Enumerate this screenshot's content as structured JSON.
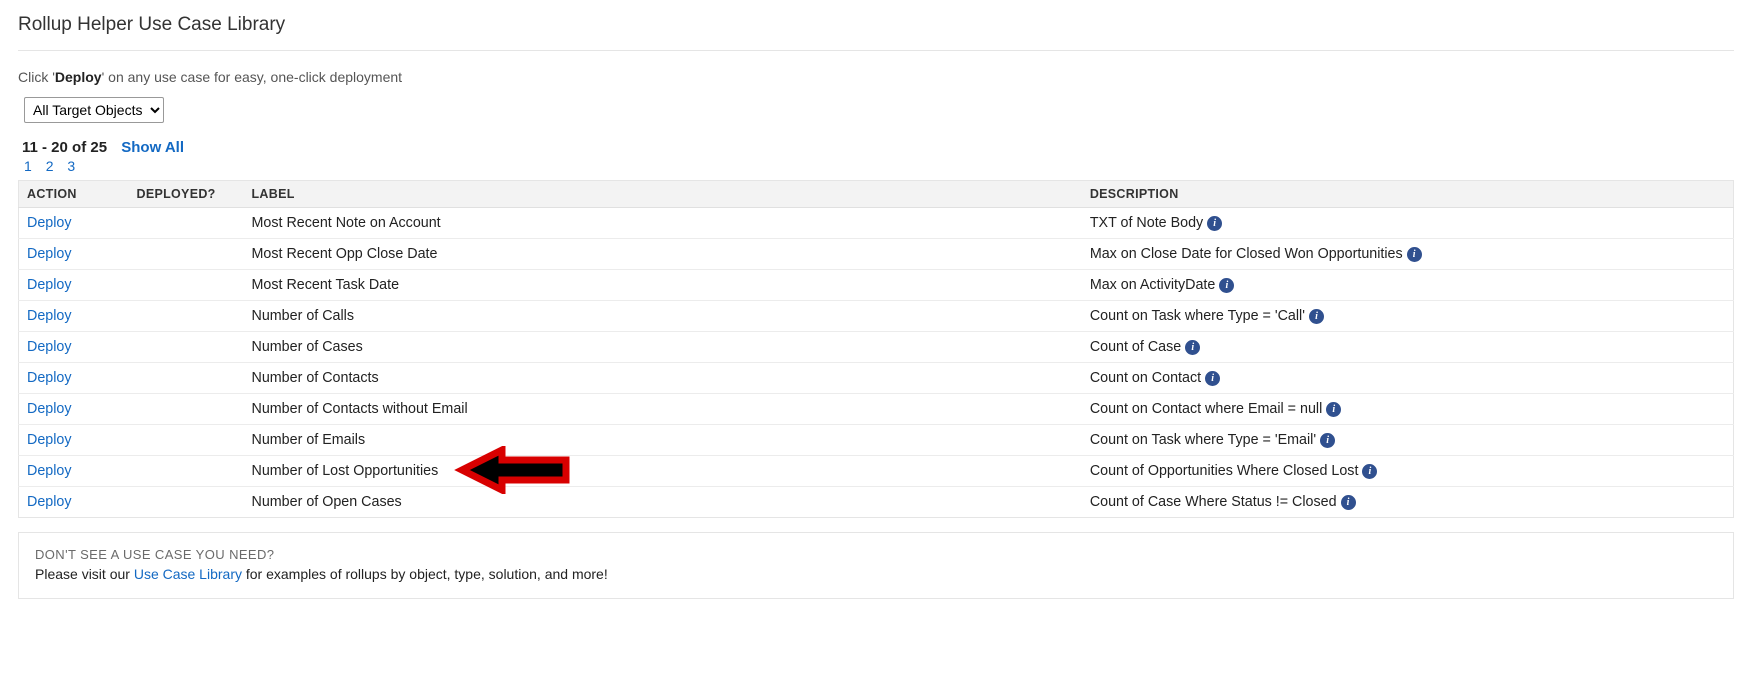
{
  "title": "Rollup Helper Use Case Library",
  "instruction_prefix": "Click '",
  "instruction_bold": "Deploy",
  "instruction_suffix": "' on any use case for easy, one-click deployment",
  "filter_selected": "All Target Objects",
  "paging_range": "11 - 20 of 25",
  "show_all": "Show All",
  "page_links": [
    "1",
    "2",
    "3"
  ],
  "columns": {
    "action": "ACTION",
    "deployed": "DEPLOYED?",
    "label": "LABEL",
    "description": "DESCRIPTION"
  },
  "rows": [
    {
      "action": "Deploy",
      "label": "Most Recent Note on Account",
      "description": "TXT of Note Body"
    },
    {
      "action": "Deploy",
      "label": "Most Recent Opp Close Date",
      "description": "Max on Close Date for Closed Won Opportunities"
    },
    {
      "action": "Deploy",
      "label": "Most Recent Task Date",
      "description": "Max on ActivityDate"
    },
    {
      "action": "Deploy",
      "label": "Number of Calls",
      "description": "Count on Task where Type = 'Call'"
    },
    {
      "action": "Deploy",
      "label": "Number of Cases",
      "description": "Count of Case"
    },
    {
      "action": "Deploy",
      "label": "Number of Contacts",
      "description": "Count on Contact"
    },
    {
      "action": "Deploy",
      "label": "Number of Contacts without Email",
      "description": "Count on Contact where Email = null"
    },
    {
      "action": "Deploy",
      "label": "Number of Emails",
      "description": "Count on Task where Type = 'Email'"
    },
    {
      "action": "Deploy",
      "label": "Number of Lost Opportunities",
      "description": "Count of Opportunities Where Closed Lost"
    },
    {
      "action": "Deploy",
      "label": "Number of Open Cases",
      "description": "Count of Case Where Status != Closed"
    }
  ],
  "footer": {
    "question": "DON'T SEE A USE CASE YOU NEED?",
    "text_pre": "Please visit our ",
    "link": "Use Case Library",
    "text_post": " for examples of rollups by object, type, solution, and more!"
  },
  "arrow_target_row_index": 8
}
